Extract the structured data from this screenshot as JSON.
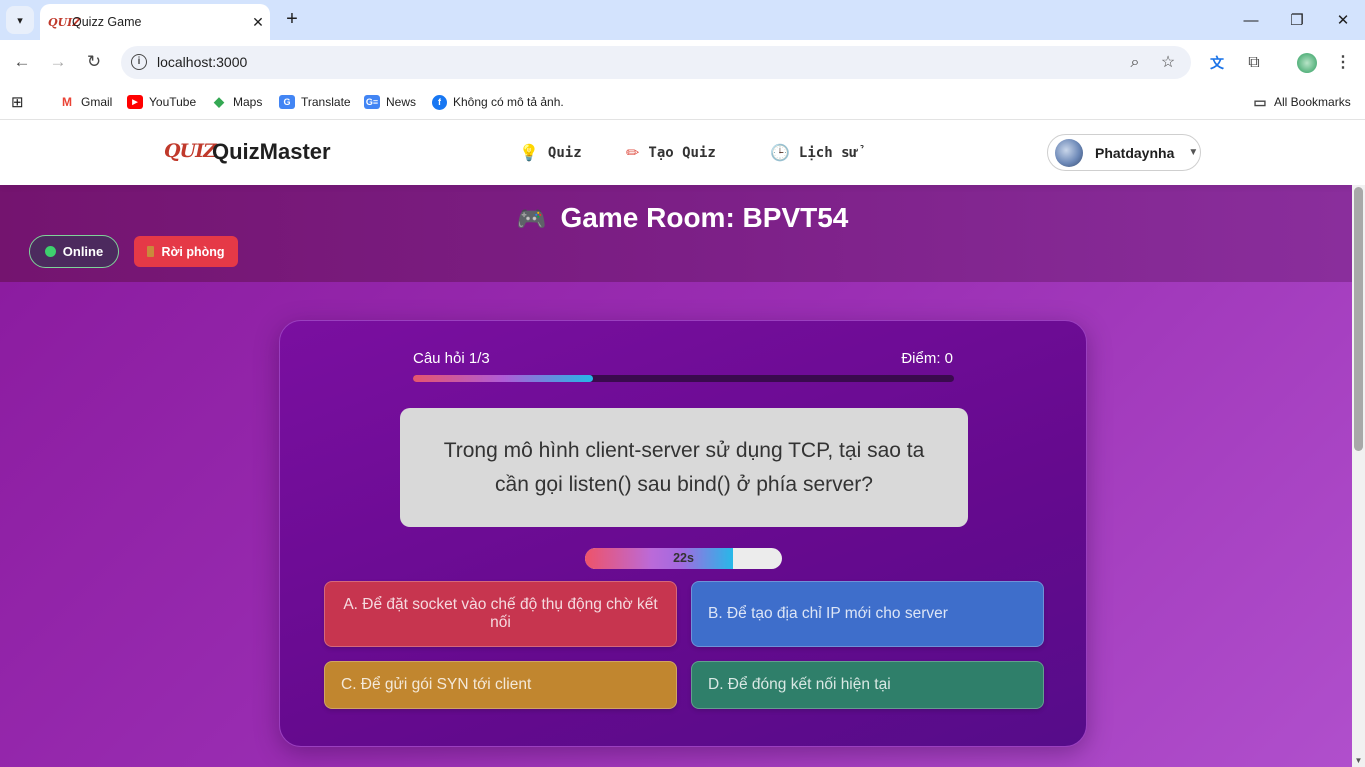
{
  "browser": {
    "tab_title": "Quizz Game",
    "tab_favicon": "QUIZ",
    "url": "localhost:3000",
    "bookmarks": [
      {
        "label": "Gmail",
        "icon": "gmail-icon",
        "color": "#ea4335"
      },
      {
        "label": "YouTube",
        "icon": "youtube-icon",
        "color": "#ff0000"
      },
      {
        "label": "Maps",
        "icon": "maps-icon",
        "color": "#34a853"
      },
      {
        "label": "Translate",
        "icon": "translate-icon",
        "color": "#4285f4"
      },
      {
        "label": "News",
        "icon": "news-icon",
        "color": "#4285f4"
      },
      {
        "label": "Không có mô tả ảnh.",
        "icon": "facebook-icon",
        "color": "#1877f2"
      }
    ],
    "all_bookmarks": "All Bookmarks"
  },
  "header": {
    "logo_badge": "QUIZ",
    "logo_text": "QuizMaster",
    "nav": [
      {
        "label": "Quiz",
        "icon": "lightbulb-icon"
      },
      {
        "label": "Tạo Quiz",
        "icon": "pencil-icon"
      },
      {
        "label": "Lịch sử",
        "icon": "clock-icon"
      }
    ],
    "user_name": "Phatdaynha"
  },
  "room": {
    "title": "Game Room: BPVT54",
    "status": "Online",
    "leave_label": "Rời phòng"
  },
  "quiz": {
    "question_counter": "Câu hỏi 1/3",
    "score_label": "Điểm: 0",
    "progress_fraction": 0.333,
    "question": "Trong mô hình client-server sử dụng TCP, tại sao ta cần gọi listen() sau bind() ở phía server?",
    "timer_label": "22s",
    "timer_fraction": 0.75,
    "answers": [
      {
        "label": "A. Để đặt socket vào chế độ thụ động chờ kết nối",
        "color": "#c7354f"
      },
      {
        "label": "B. Để tạo địa chỉ IP mới cho server",
        "color": "#3e6ecb"
      },
      {
        "label": "C. Để gửi gói SYN tới client",
        "color": "#c1862f"
      },
      {
        "label": "D. Để đóng kết nối hiện tại",
        "color": "#2f7f6a"
      }
    ]
  },
  "colors": {
    "accent": "#8a1a9e",
    "leave_button": "#e53947",
    "online_dot": "#3ecf6e"
  }
}
